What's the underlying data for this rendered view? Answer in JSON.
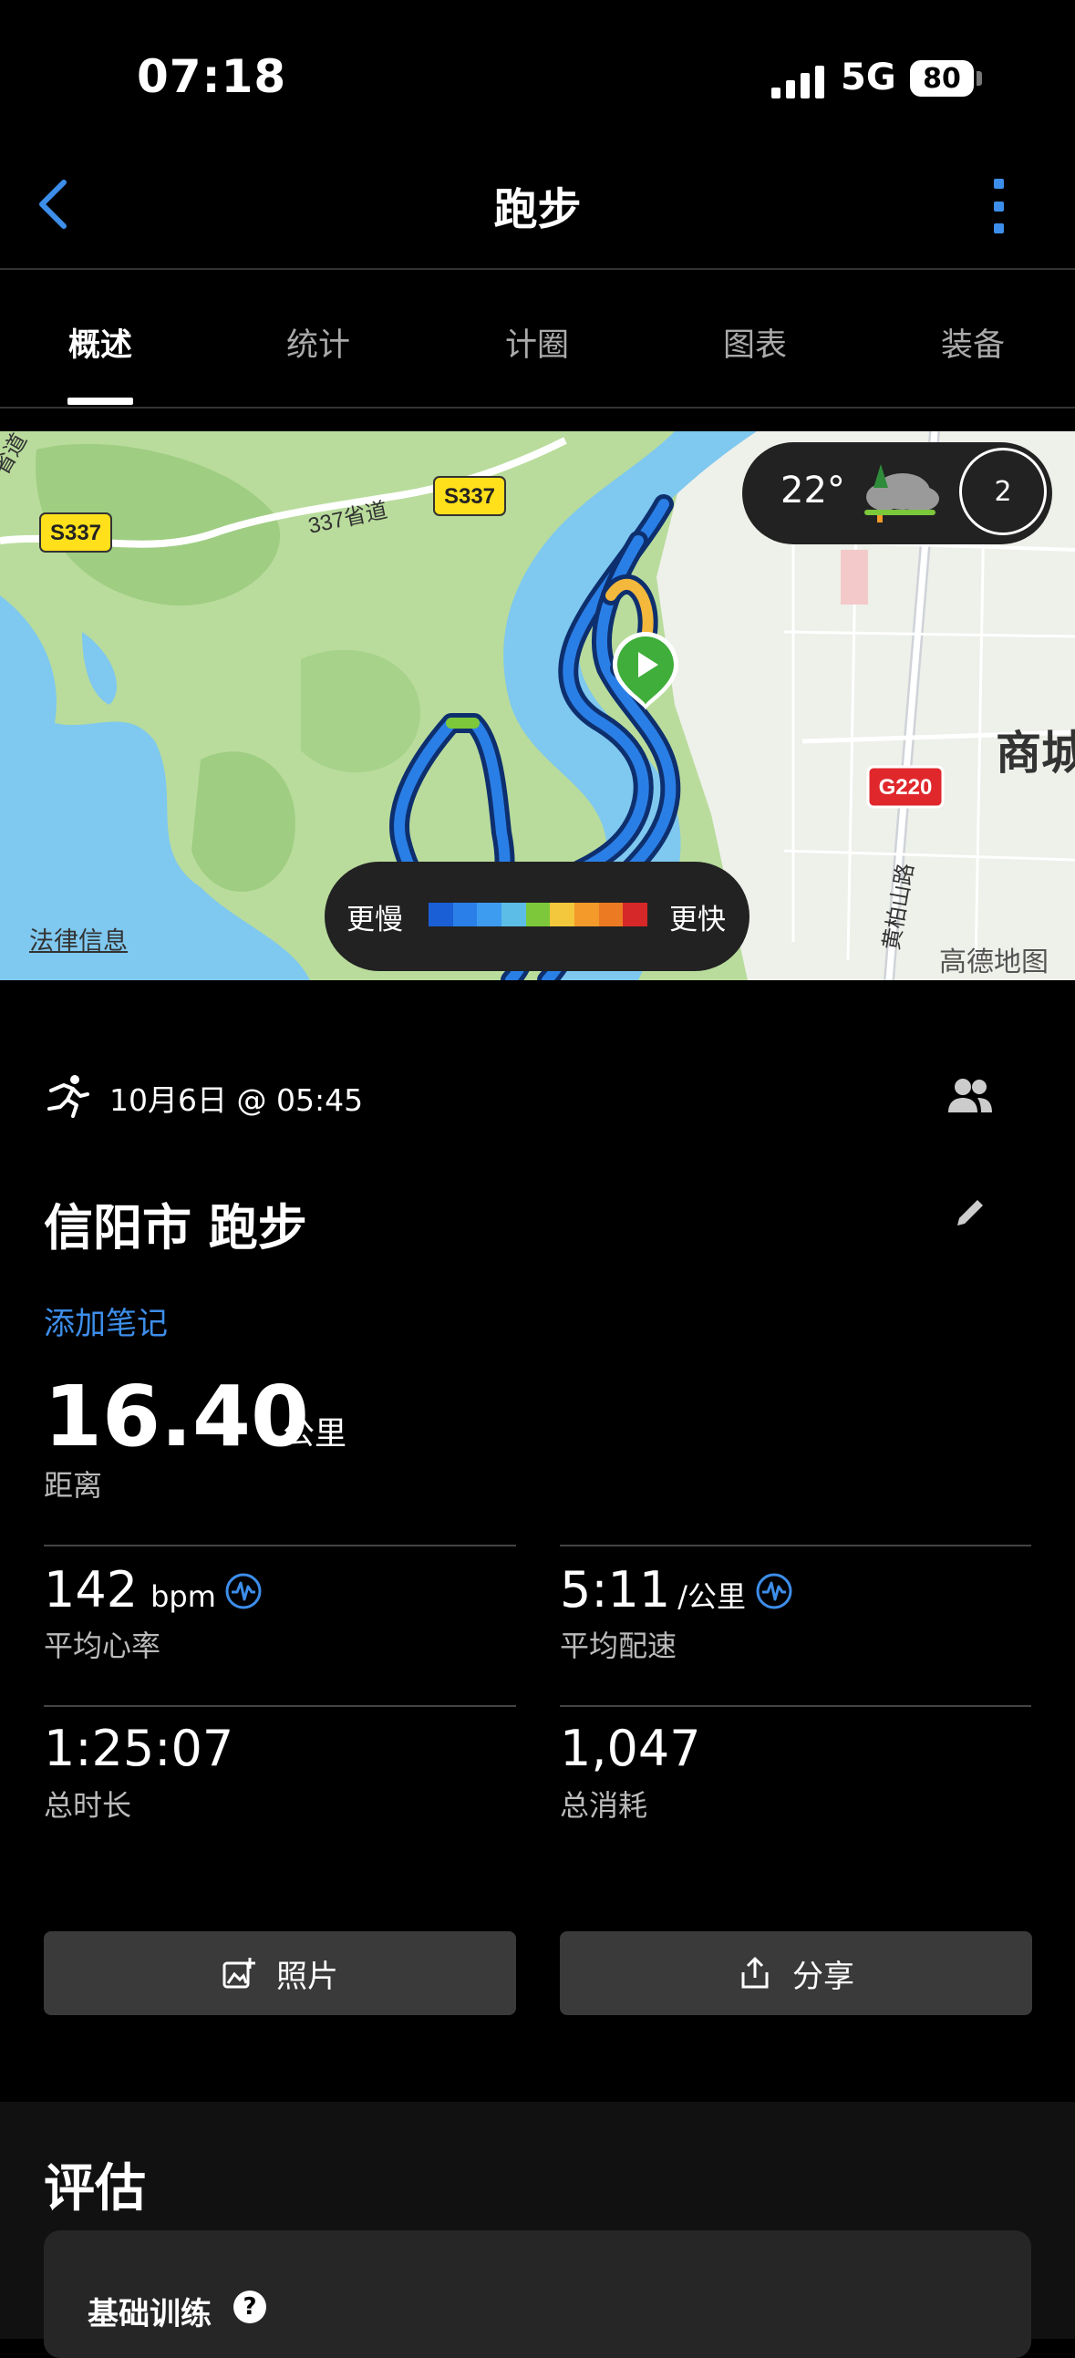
{
  "status_bar": {
    "time": "07:18",
    "network": "5G",
    "battery": "80"
  },
  "nav": {
    "title": "跑步"
  },
  "tabs": [
    {
      "label": "概述",
      "active": true
    },
    {
      "label": "统计",
      "active": false
    },
    {
      "label": "计圈",
      "active": false
    },
    {
      "label": "图表",
      "active": false
    },
    {
      "label": "装备",
      "active": false
    }
  ],
  "map": {
    "road_labels": [
      "S337",
      "S337",
      "337省道",
      "G220",
      "黄柏山路",
      "省道",
      "商城"
    ],
    "legal_link": "法律信息",
    "provider": "高德地图",
    "weather": {
      "temperature": "22°",
      "icon": "cloudy-rain-icon",
      "wind": "2"
    },
    "legend": {
      "slow_label": "更慢",
      "fast_label": "更快",
      "colors": [
        "#1a5fd6",
        "#2a80e8",
        "#3d9cf0",
        "#5cbde6",
        "#7cc83a",
        "#f3c83c",
        "#f39a2a",
        "#ec7a22",
        "#d62828"
      ]
    }
  },
  "activity": {
    "date": "10月6日 @ 05:45",
    "title": "信阳市 跑步",
    "add_note": "添加笔记",
    "distance": {
      "value": "16.40",
      "unit": "公里",
      "label": "距离"
    }
  },
  "stats": [
    {
      "value": "142",
      "unit": "bpm",
      "label": "平均心率",
      "has_icon": true
    },
    {
      "value": "5:11",
      "unit": "/公里",
      "label": "平均配速",
      "has_icon": true
    },
    {
      "value": "1:25:07",
      "unit": "",
      "label": "总时长",
      "has_icon": false
    },
    {
      "value": "1,047",
      "unit": "",
      "label": "总消耗",
      "has_icon": false
    }
  ],
  "buttons": {
    "photo": "照片",
    "share": "分享"
  },
  "evaluation": {
    "title": "评估",
    "item": "基础训练",
    "help": "?"
  },
  "colors": {
    "accent": "#3d8eea",
    "background": "#000000",
    "button": "#3a3a3a"
  }
}
